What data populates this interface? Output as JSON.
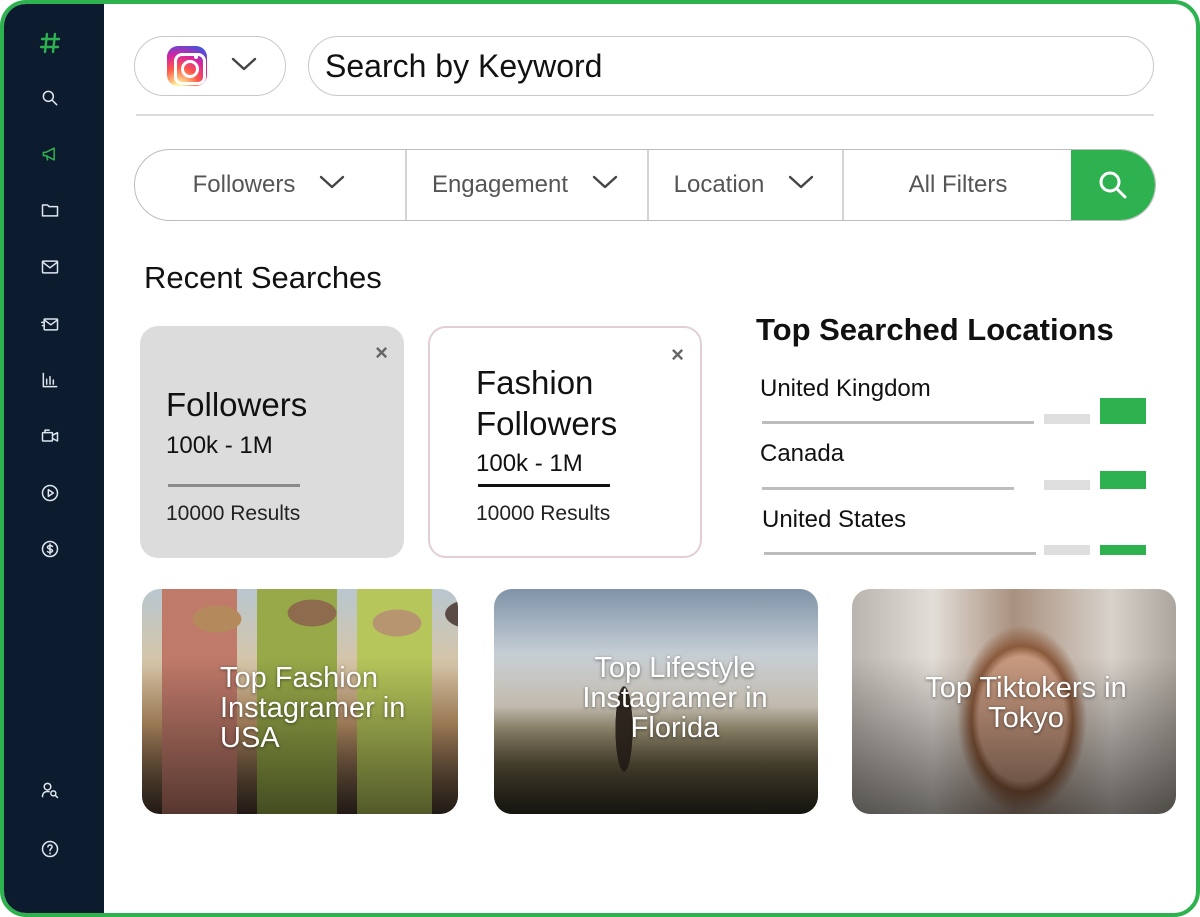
{
  "sidebar": {
    "icons": [
      "hashtag-icon",
      "search-icon",
      "megaphone-icon",
      "folder-icon",
      "mail-icon",
      "send-mail-icon",
      "bar-chart-icon",
      "video-camera-icon",
      "play-circle-icon",
      "dollar-circle-icon",
      "user-search-icon",
      "help-circle-icon"
    ],
    "active": "megaphone-icon",
    "accent": "#2db24f",
    "background": "#0c1c2e"
  },
  "search": {
    "platform": "instagram-icon",
    "placeholder": "Search by Keyword"
  },
  "filters": {
    "followers": "Followers",
    "engagement": "Engagement",
    "location": "Location",
    "all_filters": "All Filters"
  },
  "recent": {
    "title": "Recent Searches",
    "cards": [
      {
        "title": "Followers",
        "range": "100k - 1M",
        "results": "10000 Results",
        "close": "×"
      },
      {
        "title": "Fashion Followers",
        "range": "100k - 1M",
        "results": "10000 Results",
        "close": "×"
      }
    ]
  },
  "locations": {
    "title": "Top Searched Locations",
    "items": [
      {
        "name": "United Kingdom"
      },
      {
        "name": "Canada"
      },
      {
        "name": "United States"
      }
    ]
  },
  "featured": [
    {
      "caption": "Top Fashion Instagramer in USA"
    },
    {
      "caption": "Top Lifestyle Instagramer in Florida"
    },
    {
      "caption": "Top Tiktokers in Tokyo"
    }
  ]
}
